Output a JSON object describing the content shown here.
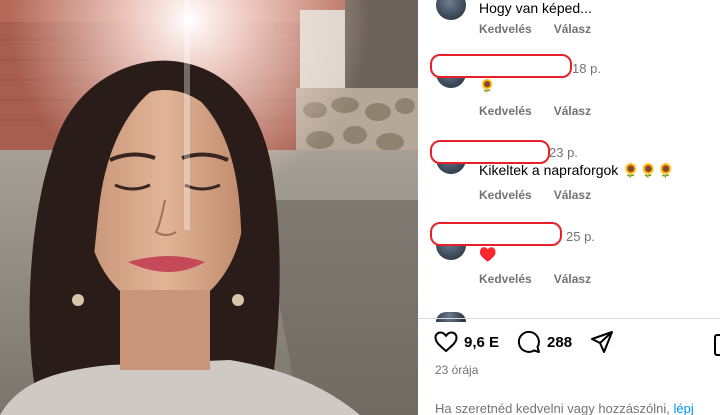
{
  "post": {
    "likes": "9,6 E",
    "comments": "288",
    "posted_ago": "23 órája",
    "login_prompt": "Ha szeretnéd kedvelni vagy hozzászólni,",
    "login_link": "lépj"
  },
  "comments": [
    {
      "text": "Hogy van képed...",
      "time": "",
      "like_label": "Kedvelés",
      "reply_label": "Válasz"
    },
    {
      "text": "🌻",
      "time": "18 p.",
      "like_label": "Kedvelés",
      "reply_label": "Válasz"
    },
    {
      "text": "Kikeltek a napraforgok 🌻🌻🌻",
      "time": "23 p.",
      "like_label": "Kedvelés",
      "reply_label": "Válasz"
    },
    {
      "text": "♥️",
      "time": "25 p.",
      "like_label": "Kedvelés",
      "reply_label": "Válasz"
    }
  ],
  "colors": {
    "redaction": "#e8202a",
    "link": "#0095f6",
    "heart": "#ed4956"
  }
}
